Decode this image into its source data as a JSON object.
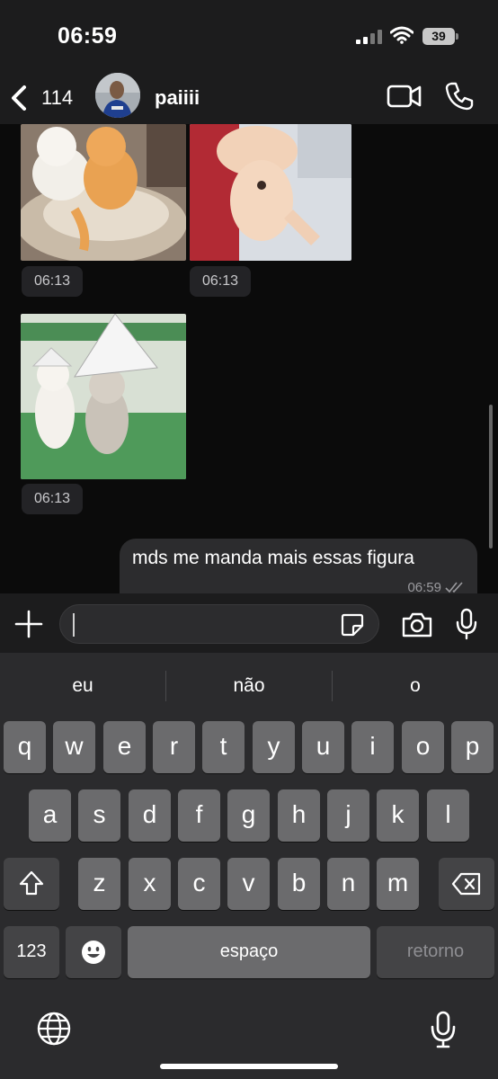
{
  "status_bar": {
    "time": "06:59",
    "battery": "39"
  },
  "header": {
    "back_count": "114",
    "contact_name": "paiiii",
    "icons": [
      "chevron-left-icon",
      "video-camera-icon",
      "phone-icon"
    ]
  },
  "messages": {
    "image_timestamps": [
      "06:13",
      "06:13",
      "06:13"
    ],
    "outgoing_text": "mds me manda mais essas figura",
    "outgoing_time": "06:59"
  },
  "input": {
    "value": "",
    "icons": [
      "plus-icon",
      "sticker-icon",
      "camera-icon",
      "microphone-icon"
    ]
  },
  "keyboard": {
    "suggestions": [
      "eu",
      "não",
      "o"
    ],
    "row1": [
      "q",
      "w",
      "e",
      "r",
      "t",
      "y",
      "u",
      "i",
      "o",
      "p"
    ],
    "row2": [
      "a",
      "s",
      "d",
      "f",
      "g",
      "h",
      "j",
      "k",
      "l"
    ],
    "row3": [
      "z",
      "x",
      "c",
      "v",
      "b",
      "n",
      "m"
    ],
    "numbers_label": "123",
    "space_label": "espaço",
    "return_label": "retorno",
    "icons": [
      "shift-icon",
      "backspace-icon",
      "emoji-icon",
      "globe-icon",
      "dictation-icon"
    ]
  },
  "colors": {
    "chat_background": "#0b0b0b",
    "bar_background": "#1c1c1d",
    "bubble": "#2c2c2e",
    "key": "#6b6b6d",
    "function_key": "#444446"
  }
}
